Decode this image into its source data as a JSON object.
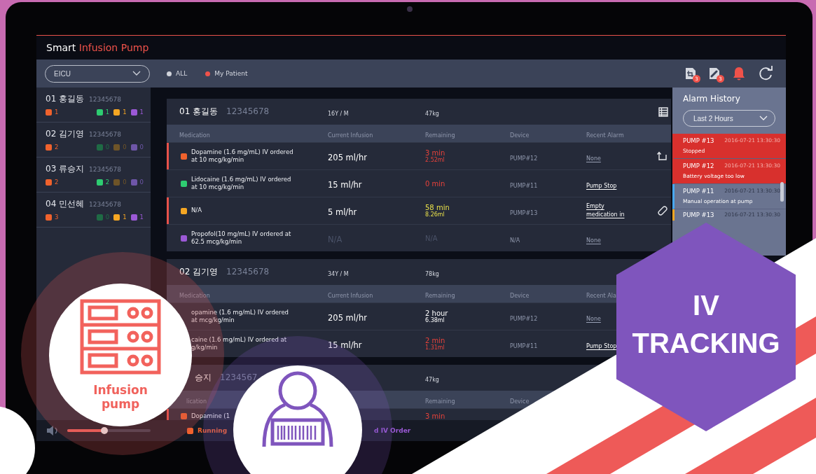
{
  "app": {
    "title": "Smart",
    "title_accent": "Infusion Pump"
  },
  "toolbar": {
    "ward": "EICU",
    "filters": [
      {
        "label": "ALL",
        "selected": false
      },
      {
        "label": "My Patient",
        "selected": true
      }
    ],
    "badges": [
      "3",
      "3"
    ]
  },
  "patients": [
    {
      "name": "01 홍길동",
      "id": "12345678",
      "counters": [
        {
          "count": "1",
          "color": "#f0622d"
        },
        {
          "count": "1",
          "color": "#2ecc71"
        },
        {
          "count": "1",
          "color": "#f5a623"
        },
        {
          "count": "1",
          "color": "#9b59d6"
        }
      ]
    },
    {
      "name": "02 김기영",
      "id": "12345678",
      "counters": [
        {
          "count": "2",
          "color": "#f0622d"
        },
        {
          "count": "0",
          "color": "#1f6b45"
        },
        {
          "count": "0",
          "color": "#6e5428"
        },
        {
          "count": "0",
          "color": "#6e56a8"
        }
      ]
    },
    {
      "name": "03 류승지",
      "id": "12345678",
      "counters": [
        {
          "count": "2",
          "color": "#f0622d"
        },
        {
          "count": "2",
          "color": "#2ecc71"
        },
        {
          "count": "0",
          "color": "#6e5428"
        },
        {
          "count": "0",
          "color": "#6e56a8"
        }
      ]
    },
    {
      "name": "04 민선혜",
      "id": "12345678",
      "counters": [
        {
          "count": "3",
          "color": "#f0622d"
        },
        {
          "count": "0",
          "color": "#1f6b45"
        },
        {
          "count": "1",
          "color": "#f5a623"
        },
        {
          "count": "1",
          "color": "#9b59d6"
        }
      ]
    }
  ],
  "volume": {
    "level": 0.45
  },
  "cards": [
    {
      "name": "01 홍길동",
      "id": "12345678",
      "age": "16Y / M",
      "weight": "47kg",
      "columns": {
        "medication": "Medication",
        "infusion": "Current Infusion",
        "remaining": "Remaining",
        "device": "Device",
        "alarm": "Recent Alarm"
      },
      "rows": [
        {
          "alert": true,
          "color": "#f0622d",
          "medication": "Dopamine (1.6 mg/mL) IV ordered at 10 mcg/kg/min",
          "infusion": "205 ml/hr",
          "idle": false,
          "remaining": {
            "text": "3 min",
            "sub": "2.52ml",
            "kind": "danger"
          },
          "device": "PUMP#12",
          "alarm": {
            "text": "None",
            "active": false
          },
          "action": {
            "kind": "swap"
          }
        },
        {
          "alert": false,
          "color": "#2ecc71",
          "medication": "Lidocaine (1.6 mg/mL) IV ordered at 10 mcg/kg/min",
          "infusion": "15 ml/hr",
          "idle": false,
          "remaining": {
            "text": "0 min",
            "kind": "danger"
          },
          "device": "PUMP#11",
          "alarm": {
            "text": "Pump Stop",
            "active": true
          }
        },
        {
          "alert": true,
          "color": "#f5a623",
          "medication": "N/A",
          "infusion": "5 ml/hr",
          "idle": false,
          "remaining": {
            "text": "58 min",
            "sub": "8.26ml",
            "kind": "warning"
          },
          "device": "PUMP#13",
          "alarm": {
            "text": "Empty medication in",
            "active": true
          },
          "action": {
            "kind": "pill"
          }
        },
        {
          "alert": false,
          "color": "#9b59d6",
          "medication": "Propofol(10 mg/mL) IV ordered at 62.5 mcg/kg/min",
          "infusion": "N/A",
          "idle": true,
          "remaining": {
            "text": "N/A",
            "kind": "idle"
          },
          "device": "N/A",
          "alarm": {
            "text": "None",
            "active": false
          }
        }
      ]
    },
    {
      "name": "02 김기영",
      "id": "12345678",
      "age": "34Y / M",
      "weight": "78kg",
      "columns": {
        "medication": "Medication",
        "infusion": "Current Infusion",
        "remaining": "Remaining",
        "device": "Device",
        "alarm": "Recent Ala"
      },
      "rows": [
        {
          "medication": "opamine (1.6 mg/mL) IV ordered at mcg/kg/min",
          "infusion": "205 ml/hr",
          "idle": false,
          "remaining": {
            "text": "2 hour",
            "sub": "6.38ml",
            "kind": "normal"
          },
          "device": "PUMP#12",
          "alarm": {
            "text": "None",
            "active": false
          }
        },
        {
          "medication": "caine (1.6 mg/mL) IV ordered at g/kg/min",
          "infusion": "15 ml/hr",
          "idle": false,
          "remaining": {
            "text": "2 min",
            "sub": "1.31ml",
            "kind": "danger"
          },
          "device": "PUMP#11",
          "alarm": {
            "text": "Pump Stop",
            "active": true
          }
        }
      ]
    },
    {
      "name": "승지",
      "id": "1234567",
      "weight": "47kg",
      "columns": {
        "medication": "lication",
        "remaining": "Remaining",
        "device": "Device"
      },
      "rows": [
        {
          "alert": true,
          "color": "#f0622d",
          "medication": "Dopamine (1",
          "remaining": {
            "text": "3 min",
            "kind": "danger"
          }
        }
      ]
    }
  ],
  "legend": [
    {
      "label": "Running",
      "color": "#f0622d",
      "icon": true
    },
    {
      "label": "d IV Order",
      "color": "#9b59d6",
      "icon": false
    }
  ],
  "alarm_history": {
    "title": "Alarm History",
    "range": "Last 2 Hours",
    "items": [
      {
        "pump": "PUMP #13",
        "time": "2016-07-21 13:30:30",
        "message": "Stopped",
        "kind": "critical"
      },
      {
        "pump": "PUMP #12",
        "time": "2016-07-21 13:30:30",
        "message": "Battery voltage too low",
        "kind": "critical"
      },
      {
        "pump": "PUMP #11",
        "time": "2016-07-21 13:30:30",
        "message": "Manual operation at pump",
        "kind": "info"
      },
      {
        "pump": "PUMP #13",
        "time": "2016-07-21 13:30:30",
        "kind": "warning"
      }
    ]
  },
  "promo": {
    "device_label": "Infusion pump",
    "badge": [
      "IV",
      "TRACKING"
    ]
  }
}
